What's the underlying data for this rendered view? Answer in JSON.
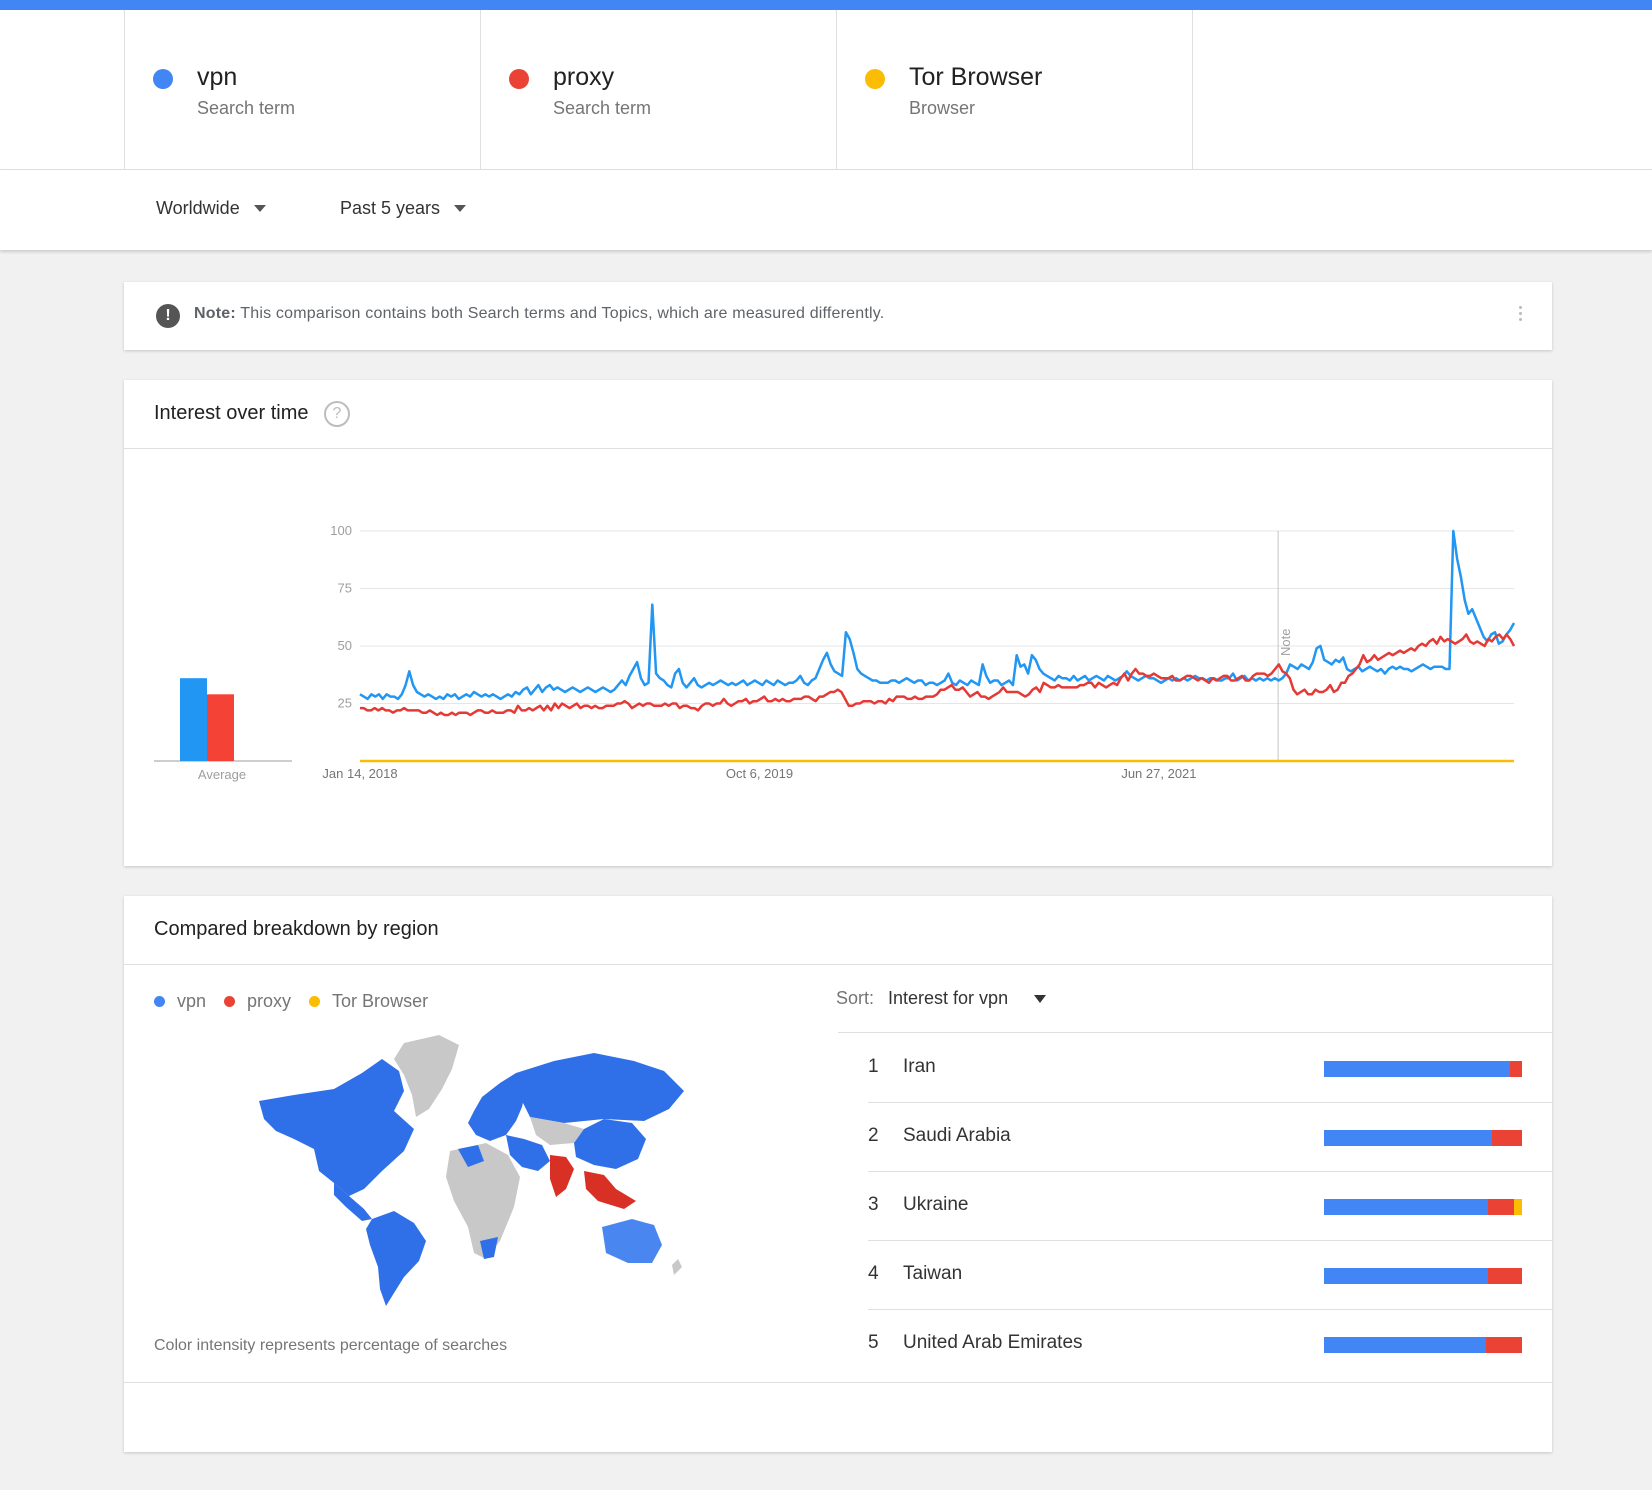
{
  "colors": {
    "vpn": "#4285f4",
    "vpn_line": "#2196f3",
    "proxy": "#ea4335",
    "tor": "#fbbc04",
    "accent_bar": "#4285f4"
  },
  "terms": [
    {
      "name": "vpn",
      "type": "Search term",
      "color": "#4285f4"
    },
    {
      "name": "proxy",
      "type": "Search term",
      "color": "#ea4335"
    },
    {
      "name": "Tor Browser",
      "type": "Browser",
      "color": "#fbbc04"
    }
  ],
  "filters": {
    "region": "Worldwide",
    "period": "Past 5 years"
  },
  "note": {
    "icon": "exclamation-icon",
    "bold": "Note:",
    "text": "This comparison contains both Search terms and Topics, which are measured differently."
  },
  "interest_over_time": {
    "title": "Interest over time",
    "help_icon": "question-mark-icon",
    "average_label": "Average",
    "note_marker_label": "Note"
  },
  "chart_data": {
    "type": "line",
    "title": "Interest over time",
    "ylim": [
      0,
      100
    ],
    "yticks": [
      25,
      50,
      75,
      100
    ],
    "xtick_labels": [
      "Jan 14, 2018",
      "Oct 6, 2019",
      "Jun 27, 2021"
    ],
    "x_range": [
      "Jan 14, 2018",
      "Jan 8, 2023"
    ],
    "note_marker_date": "Jan 1, 2022",
    "averages": [
      {
        "name": "vpn",
        "value": 36
      },
      {
        "name": "proxy",
        "value": 29
      },
      {
        "name": "Tor Browser",
        "value": 0
      }
    ],
    "series": [
      {
        "name": "vpn",
        "color": "#2196f3",
        "values": [
          29,
          28,
          27,
          29,
          28,
          29,
          27,
          29,
          28,
          28,
          27,
          29,
          33,
          39,
          33,
          30,
          29,
          28,
          29,
          28,
          27,
          28,
          27,
          29,
          28,
          29,
          27,
          28,
          29,
          28,
          30,
          29,
          28,
          29,
          28,
          29,
          28,
          27,
          28,
          29,
          28,
          30,
          29,
          31,
          32,
          29,
          31,
          33,
          30,
          32,
          33,
          31,
          32,
          31,
          30,
          31,
          32,
          31,
          30,
          31,
          32,
          31,
          30,
          31,
          32,
          31,
          30,
          31,
          33,
          35,
          33,
          37,
          40,
          43,
          36,
          33,
          34,
          68,
          38,
          36,
          35,
          33,
          32,
          38,
          40,
          34,
          32,
          34,
          36,
          33,
          32,
          33,
          34,
          33,
          34,
          35,
          34,
          33,
          34,
          33,
          34,
          35,
          33,
          34,
          35,
          34,
          33,
          35,
          34,
          33,
          35,
          34,
          33,
          34,
          34,
          35,
          37,
          34,
          33,
          35,
          36,
          40,
          44,
          47,
          42,
          39,
          38,
          37,
          56,
          53,
          47,
          40,
          38,
          37,
          36,
          35,
          35,
          34,
          34,
          34,
          35,
          35,
          34,
          35,
          36,
          35,
          34,
          35,
          35,
          33,
          34,
          34,
          33,
          34,
          35,
          38,
          34,
          33,
          35,
          34,
          33,
          35,
          34,
          33,
          42,
          37,
          34,
          35,
          35,
          33,
          34,
          35,
          33,
          46,
          41,
          42,
          38,
          46,
          44,
          40,
          38,
          37,
          36,
          35,
          37,
          36,
          36,
          35,
          37,
          35,
          36,
          37,
          35,
          36,
          37,
          36,
          35,
          37,
          36,
          35,
          36,
          37,
          39,
          37,
          36,
          35,
          36,
          37,
          36,
          36,
          35,
          34,
          35,
          36,
          35,
          36,
          35,
          36,
          35,
          36,
          37,
          36,
          36,
          35,
          36,
          36,
          35,
          35,
          36,
          36,
          38,
          35,
          36,
          37,
          35,
          36,
          35,
          36,
          35,
          36,
          35,
          36,
          35,
          36,
          38,
          42,
          41,
          40,
          42,
          41,
          40,
          43,
          49,
          50,
          44,
          43,
          42,
          44,
          43,
          45,
          40,
          39,
          40,
          41,
          39,
          40,
          41,
          40,
          39,
          40,
          38,
          40,
          41,
          40,
          41,
          40,
          40,
          39,
          40,
          41,
          42,
          41,
          40,
          41,
          41,
          41,
          40,
          40,
          100,
          88,
          80,
          70,
          64,
          66,
          62,
          58,
          54,
          52,
          55,
          56,
          51,
          52,
          55,
          57,
          60
        ]
      },
      {
        "name": "proxy",
        "color": "#e53935",
        "values": [
          23,
          23,
          22,
          22,
          23,
          22,
          23,
          22,
          22,
          21,
          22,
          22,
          23,
          22,
          22,
          22,
          22,
          21,
          21,
          22,
          21,
          20,
          21,
          20,
          20,
          21,
          20,
          21,
          21,
          21,
          20,
          21,
          22,
          22,
          21,
          21,
          22,
          21,
          21,
          21,
          22,
          22,
          21,
          24,
          22,
          22,
          23,
          22,
          23,
          24,
          22,
          24,
          22,
          25,
          23,
          25,
          24,
          23,
          24,
          25,
          23,
          24,
          24,
          23,
          24,
          23,
          23,
          24,
          24,
          24,
          25,
          25,
          26,
          25,
          23,
          24,
          25,
          24,
          25,
          25,
          24,
          24,
          24,
          25,
          24,
          25,
          25,
          23,
          24,
          24,
          23,
          23,
          22,
          24,
          25,
          25,
          24,
          25,
          25,
          27,
          25,
          24,
          25,
          26,
          26,
          27,
          25,
          26,
          26,
          27,
          28,
          26,
          26,
          27,
          26,
          27,
          26,
          26,
          27,
          27,
          27,
          28,
          28,
          27,
          26,
          28,
          28,
          29,
          30,
          30,
          31,
          30,
          27,
          24,
          24,
          25,
          25,
          26,
          26,
          26,
          25,
          26,
          26,
          25,
          27,
          26,
          28,
          28,
          28,
          27,
          27,
          28,
          27,
          27,
          28,
          28,
          28,
          29,
          31,
          31,
          32,
          33,
          31,
          31,
          32,
          30,
          28,
          29,
          30,
          28,
          28,
          27,
          28,
          29,
          30,
          32,
          30,
          30,
          30,
          30,
          29,
          28,
          29,
          31,
          32,
          30,
          34,
          33,
          32,
          32,
          33,
          32,
          32,
          32,
          32,
          32,
          33,
          33,
          34,
          34,
          32,
          34,
          33,
          32,
          33,
          34,
          33,
          36,
          38,
          35,
          38,
          40,
          38,
          38,
          37,
          37,
          38,
          37,
          36,
          36,
          36,
          37,
          35,
          35,
          36,
          37,
          37,
          36,
          35,
          36,
          35,
          34,
          36,
          35,
          36,
          37,
          37,
          35,
          35,
          36,
          37,
          35,
          35,
          37,
          38,
          38,
          38,
          37,
          38,
          40,
          42,
          39,
          38,
          36,
          31,
          29,
          30,
          31,
          29,
          29,
          31,
          30,
          30,
          31,
          33,
          30,
          31,
          34,
          34,
          37,
          38,
          40,
          42,
          46,
          43,
          44,
          46,
          44,
          45,
          46,
          47,
          46,
          47,
          48,
          47,
          48,
          49,
          48,
          50,
          51,
          50,
          52,
          53,
          51,
          54,
          52,
          53,
          52,
          51,
          52,
          53,
          55,
          52,
          51,
          52,
          51,
          50,
          53,
          52,
          54,
          55,
          53,
          55,
          53,
          50
        ]
      },
      {
        "name": "Tor Browser",
        "color": "#fbbc04",
        "values": [
          0
        ]
      }
    ]
  },
  "region": {
    "title": "Compared breakdown by region",
    "legend": [
      "vpn",
      "proxy",
      "Tor Browser"
    ],
    "caption": "Color intensity represents percentage of searches",
    "sort_label": "Sort:",
    "sort_value": "Interest for vpn",
    "rows": [
      {
        "rank": "1",
        "name": "Iran",
        "shares": [
          94,
          6,
          0
        ]
      },
      {
        "rank": "2",
        "name": "Saudi Arabia",
        "shares": [
          85,
          15,
          0
        ]
      },
      {
        "rank": "3",
        "name": "Ukraine",
        "shares": [
          83,
          13,
          4
        ]
      },
      {
        "rank": "4",
        "name": "Taiwan",
        "shares": [
          83,
          17,
          0
        ]
      },
      {
        "rank": "5",
        "name": "United Arab Emirates",
        "shares": [
          82,
          18,
          0
        ]
      }
    ]
  }
}
